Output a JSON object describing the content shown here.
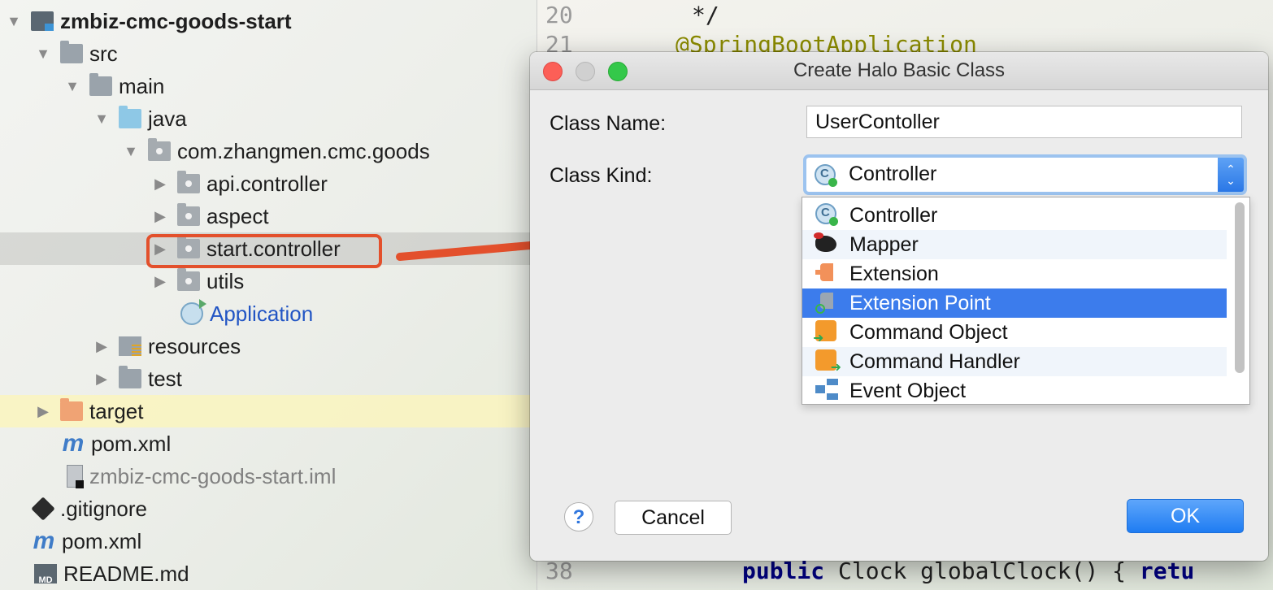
{
  "tree": {
    "items": [
      {
        "label": "zmbiz-cmc-goods-start"
      },
      {
        "label": "src"
      },
      {
        "label": "main"
      },
      {
        "label": "java"
      },
      {
        "label": "com.zhangmen.cmc.goods"
      },
      {
        "label": "api.controller"
      },
      {
        "label": "aspect"
      },
      {
        "label": "start.controller"
      },
      {
        "label": "utils"
      },
      {
        "label": "Application"
      },
      {
        "label": "resources"
      },
      {
        "label": "test"
      },
      {
        "label": "target"
      },
      {
        "label": "pom.xml"
      },
      {
        "label": "zmbiz-cmc-goods-start.iml"
      },
      {
        "label": ".gitignore"
      },
      {
        "label": "pom.xml"
      },
      {
        "label": "README.md"
      }
    ],
    "icons": {
      "md_badge": "MD",
      "maven_badge": "m"
    }
  },
  "editor": {
    "lines": [
      {
        "number": "20",
        "text": "*/"
      },
      {
        "number": "21",
        "text": "@SpringBootApplication"
      },
      {
        "number": "38",
        "pre": "public",
        "mid": " Clock globalClock() { ",
        "post": "retu"
      }
    ]
  },
  "dialog": {
    "title": "Create Halo Basic Class",
    "class_name_label": "Class  Name:",
    "class_name_value": "UserContoller",
    "class_kind_label": "Class Kind:",
    "class_kind_selected": "Controller",
    "kind_options": [
      {
        "label": "Controller",
        "icon": "controller-icon"
      },
      {
        "label": "Mapper",
        "icon": "mapper-icon"
      },
      {
        "label": "Extension",
        "icon": "extension-icon"
      },
      {
        "label": "Extension Point",
        "icon": "extension-point-icon"
      },
      {
        "label": "Command Object",
        "icon": "command-object-icon"
      },
      {
        "label": "Command Handler",
        "icon": "command-handler-icon"
      },
      {
        "label": "Event Object",
        "icon": "event-object-icon"
      }
    ],
    "highlighted_option": "Extension Point",
    "help_label": "?",
    "cancel_label": "Cancel",
    "ok_label": "OK"
  },
  "colors": {
    "annotation_arrow": "#e3502c",
    "selection_blue": "#3c7cec",
    "ok_button": "#1f7cf2"
  }
}
